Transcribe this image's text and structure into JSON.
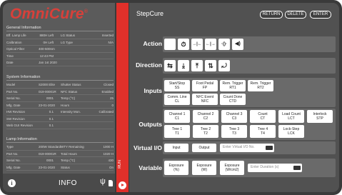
{
  "brand": {
    "name": "OmniCure",
    "reg": "®"
  },
  "general": {
    "title": "General Information",
    "rows": [
      {
        "l1": "Eff. Lamp Life",
        "v1": "880H Left",
        "l2": "LG Status",
        "v2": "Inserted"
      },
      {
        "l1": "Calibration",
        "v1": "0H Left",
        "l2": "LG Type",
        "v2": "N/A"
      },
      {
        "l1": "Optical Filter",
        "v1": "400-500nm",
        "l2": "",
        "v2": ""
      },
      {
        "l1": "Time",
        "v1": "12:43 PM",
        "l2": "",
        "v2": ""
      },
      {
        "l1": "Date",
        "v1": "Jan 1st 2020",
        "l2": "",
        "v2": ""
      }
    ]
  },
  "system": {
    "title": "System Information",
    "rows": [
      {
        "l1": "Model",
        "v1": "S2000 Elite",
        "l2": "Shutter Status",
        "v2": "Closed"
      },
      {
        "l1": "Part No.",
        "v1": "019-00001R",
        "l2": "NFC Status",
        "v2": "Enabled"
      },
      {
        "l1": "Serial No.",
        "v1": "0001",
        "l2": "Temp (°C)",
        "v2": "25"
      },
      {
        "l1": "Mfg. Date",
        "v1": "23-01-2020",
        "l2": "Hours",
        "v2": "0"
      },
      {
        "l1": "HW Revision",
        "v1": "0.1",
        "l2": "Intensity Mon.",
        "v2": "Calibrated"
      },
      {
        "l1": "SW Revision",
        "v1": "0.1",
        "l2": "",
        "v2": ""
      },
      {
        "l1": "Web GUI Revision",
        "v1": "0.1",
        "l2": "",
        "v2": ""
      }
    ]
  },
  "lamp": {
    "title": "Lamp Information",
    "rows": [
      {
        "l1": "Type",
        "v1": "200W Standard",
        "l2": "WTY Remaining",
        "v2": "1000 H"
      },
      {
        "l1": "Part No.",
        "v1": "019-00001R",
        "l2": "Total Hours",
        "v2": "1020 H"
      },
      {
        "l1": "Serial No.",
        "v1": "0001",
        "l2": "Temp (°C)",
        "v2": "430"
      },
      {
        "l1": "Mfg. Date",
        "v1": "23-01-2020",
        "l2": "Status",
        "v2": "On"
      }
    ]
  },
  "footer": {
    "info_label": "INFO"
  },
  "run": {
    "label": "RUN"
  },
  "screen": {
    "title": "StepCure",
    "return_label": "RETURN",
    "delete_label": "DELETE",
    "enter_label": "ENTER"
  },
  "rows": {
    "action": "Action",
    "direction": "Direction",
    "inputs": "Inputs",
    "outputs": "Outputs",
    "virtual_io": "Virtual I/O",
    "variable": "Variable"
  },
  "actions": [
    {
      "name": "blank",
      "glyph": ""
    },
    {
      "name": "timer",
      "glyph": "⏱"
    },
    {
      "name": "increase",
      "glyph": "→|←"
    },
    {
      "name": "decrease",
      "glyph": "←|→"
    },
    {
      "name": "pulse",
      "glyph": "·()·"
    },
    {
      "name": "beep",
      "glyph": "◀)"
    }
  ],
  "directions": [
    {
      "name": "forward-back",
      "glyph": "⇆"
    },
    {
      "name": "down",
      "glyph": "⤓"
    },
    {
      "name": "up",
      "glyph": "⤒"
    },
    {
      "name": "up-down",
      "glyph": "⇅"
    },
    {
      "name": "loop",
      "glyph": "⤾"
    }
  ],
  "inputs": [
    {
      "a": "Start/Stop",
      "b": "SS"
    },
    {
      "a": "Foot Pedal",
      "b": "FP"
    },
    {
      "a": "Rem. Trigger",
      "b": "RT1"
    },
    {
      "a": "Rem. Trigger",
      "b": "RT2"
    },
    {
      "a": "Comm. Line",
      "b": "CL"
    },
    {
      "a": "NFC Event",
      "b": "NFC"
    },
    {
      "a": "Count Done",
      "b": "CTD"
    }
  ],
  "outputs": [
    {
      "a": "Channel 1",
      "b": "C1"
    },
    {
      "a": "Channel 2",
      "b": "C2"
    },
    {
      "a": "Channel 3",
      "b": "C3"
    },
    {
      "a": "Count",
      "b": "CT"
    },
    {
      "a": "Load Count",
      "b": "LCT"
    },
    {
      "a": "Interlock",
      "b": "STP"
    },
    {
      "a": "Tree 1",
      "b": "T1"
    },
    {
      "a": "Tree 2",
      "b": "T2"
    },
    {
      "a": "Tree 3",
      "b": "T3"
    },
    {
      "a": "Tree 4",
      "b": "T4"
    },
    {
      "a": "Lock-Step",
      "b": "LCK"
    }
  ],
  "virtual": {
    "input_label": "Input",
    "output_label": "Output",
    "placeholder": "Enter Virtual I/O No."
  },
  "variables": [
    {
      "a": "Exposure",
      "b": "(%)"
    },
    {
      "a": "Exposure",
      "b": "(W)"
    },
    {
      "a": "Exposure",
      "b": "(W/cm2)"
    }
  ],
  "duration_placeholder": "Enter Duration (s)",
  "colors": {
    "brand": "#d8403a",
    "run_strip": "#e0302a",
    "panel": "#515151"
  }
}
